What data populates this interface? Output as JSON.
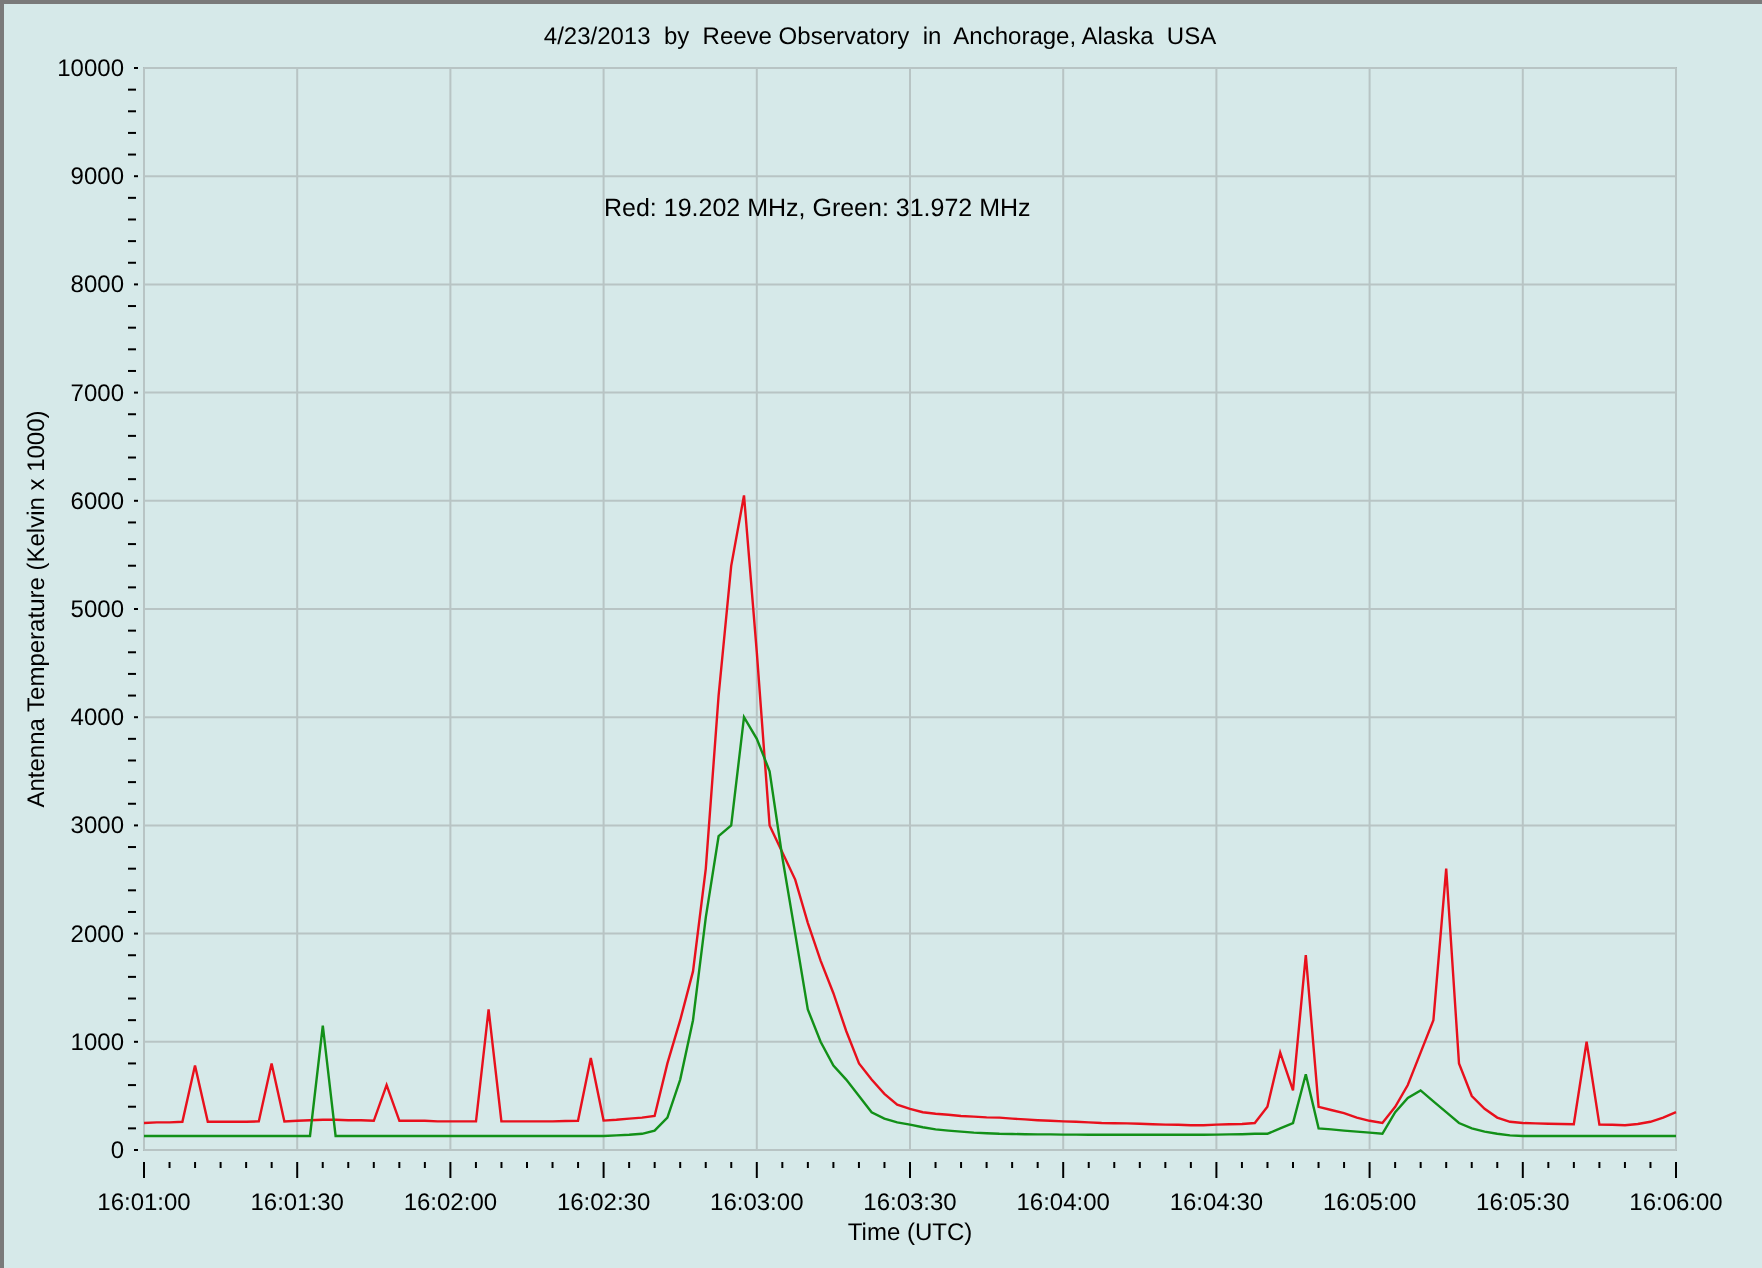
{
  "chart_data": {
    "type": "line",
    "title": "4/23/2013  by  Reeve Observatory  in  Anchorage, Alaska  USA",
    "xlabel": "Time (UTC)",
    "ylabel": "Antenna Temperature (Kelvin x 1000)",
    "categories": [
      "16:01:00",
      null,
      null,
      null,
      null,
      null,
      null,
      null,
      null,
      null,
      null,
      null,
      "16:01:30",
      null,
      null,
      null,
      null,
      null,
      null,
      null,
      null,
      null,
      null,
      null,
      "16:02:00",
      null,
      null,
      null,
      null,
      null,
      null,
      null,
      null,
      null,
      null,
      null,
      "16:02:30",
      null,
      null,
      null,
      null,
      null,
      null,
      null,
      null,
      null,
      null,
      null,
      "16:03:00",
      null,
      null,
      null,
      null,
      null,
      null,
      null,
      null,
      null,
      null,
      null,
      "16:03:30",
      null,
      null,
      null,
      null,
      null,
      null,
      null,
      null,
      null,
      null,
      null,
      "16:04:00",
      null,
      null,
      null,
      null,
      null,
      null,
      null,
      null,
      null,
      null,
      null,
      "16:04:30",
      null,
      null,
      null,
      null,
      null,
      null,
      null,
      null,
      null,
      null,
      null,
      "16:05:00",
      null,
      null,
      null,
      null,
      null,
      null,
      null,
      null,
      null,
      null,
      null,
      "16:05:30",
      null,
      null,
      null,
      null,
      null,
      null,
      null,
      null,
      null,
      null,
      null,
      "16:06:00"
    ],
    "series": [
      {
        "color": "#e8101c",
        "values": [
          250,
          255,
          255,
          260,
          780,
          260,
          260,
          260,
          260,
          265,
          800,
          265,
          270,
          275,
          280,
          280,
          275,
          275,
          270,
          600,
          270,
          270,
          270,
          265,
          265,
          265,
          265,
          1300,
          265,
          265,
          265,
          265,
          265,
          268,
          270,
          850,
          272,
          280,
          290,
          300,
          315,
          800,
          1200,
          1650,
          2600,
          4200,
          5400,
          6050,
          4600,
          3000,
          2750,
          2500,
          2100,
          1750,
          1450,
          1100,
          800,
          650,
          520,
          420,
          380,
          350,
          335,
          325,
          315,
          308,
          302,
          300,
          290,
          282,
          275,
          270,
          265,
          260,
          255,
          250,
          248,
          245,
          242,
          238,
          235,
          232,
          230,
          230,
          235,
          238,
          240,
          250,
          400,
          900,
          550,
          1800,
          400,
          370,
          340,
          300,
          270,
          250,
          400,
          600,
          900,
          1200,
          2600,
          800,
          500,
          380,
          300,
          260,
          250,
          245,
          242,
          240,
          238,
          1000,
          235,
          232,
          230,
          240,
          260,
          300,
          350
        ]
      },
      {
        "color": "#129018",
        "values": [
          130,
          130,
          130,
          130,
          130,
          130,
          130,
          130,
          130,
          130,
          130,
          130,
          130,
          130,
          1150,
          130,
          130,
          130,
          130,
          130,
          130,
          130,
          130,
          130,
          130,
          130,
          130,
          130,
          130,
          130,
          130,
          130,
          130,
          130,
          130,
          130,
          130,
          135,
          140,
          150,
          180,
          300,
          650,
          1200,
          2150,
          2900,
          3000,
          4000,
          3800,
          3500,
          2700,
          2000,
          1300,
          1000,
          780,
          650,
          500,
          350,
          290,
          255,
          235,
          210,
          190,
          180,
          170,
          160,
          155,
          150,
          148,
          146,
          145,
          144,
          143,
          142,
          141,
          140,
          140,
          140,
          140,
          140,
          140,
          140,
          140,
          140,
          142,
          144,
          146,
          150,
          150,
          200,
          250,
          700,
          200,
          190,
          180,
          170,
          160,
          150,
          350,
          480,
          550,
          450,
          350,
          250,
          200,
          170,
          150,
          135,
          130,
          130,
          130,
          130,
          130,
          130,
          130,
          130,
          130,
          130,
          130,
          130,
          130
        ]
      }
    ],
    "ylim": [
      0,
      10000
    ],
    "grid": true,
    "yticks": [
      0,
      1000,
      2000,
      3000,
      4000,
      5000,
      6000,
      7000,
      8000,
      9000,
      10000
    ],
    "annotations": [
      "Red: 19.202 MHz, Green: 31.972 MHz"
    ]
  }
}
